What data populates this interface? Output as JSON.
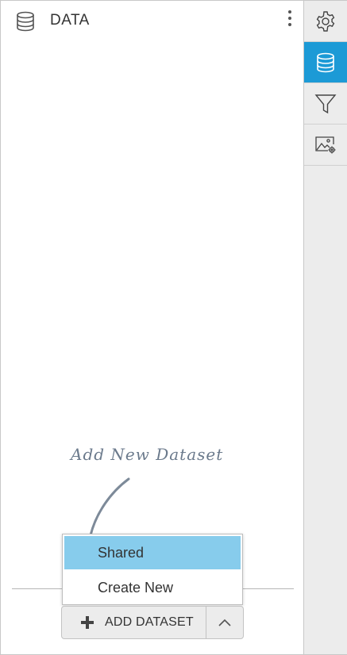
{
  "panel": {
    "title": "DATA",
    "title_icon": "database-icon",
    "menu_icon": "vertical-ellipsis-icon"
  },
  "toolbar": {
    "items": [
      {
        "icon": "gear-icon",
        "active": false
      },
      {
        "icon": "database-icon",
        "active": true
      },
      {
        "icon": "filter-icon",
        "active": false
      },
      {
        "icon": "image-settings-icon",
        "active": false
      }
    ],
    "active_color": "#1c9ad6"
  },
  "hint": {
    "text": "Add New Dataset"
  },
  "dropdown": {
    "items": [
      {
        "label": "Shared",
        "selected": true
      },
      {
        "label": "Create New",
        "selected": false
      }
    ],
    "selected_color": "#87ccec"
  },
  "add_button": {
    "label": "ADD DATASET",
    "icon": "plus-icon",
    "caret_icon": "chevron-up-icon"
  }
}
